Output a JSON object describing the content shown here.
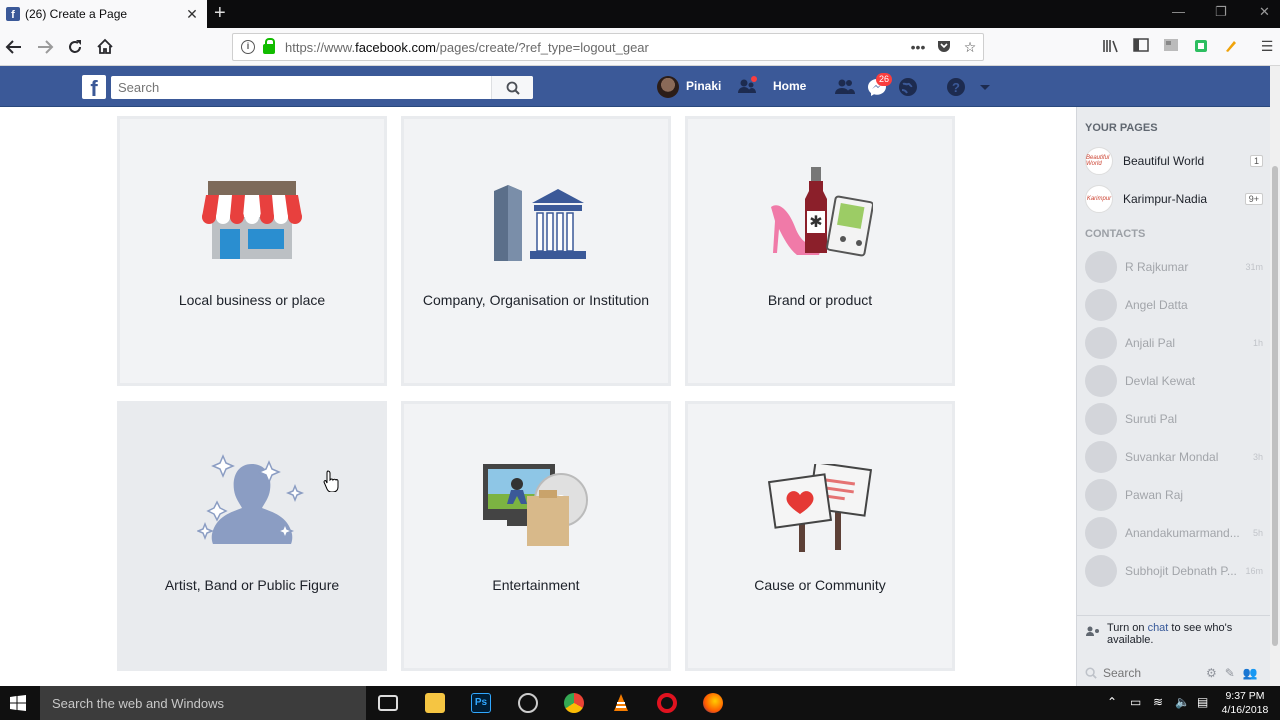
{
  "browser": {
    "tab_title": "(26) Create a Page",
    "tab_favicon": "f",
    "url_prefix": "https://www.",
    "url_domain": "facebook.com",
    "url_path": "/pages/create/?ref_type=logout_gear"
  },
  "fb": {
    "logo": "f",
    "search_placeholder": "Search",
    "user_name": "Pinaki",
    "home_label": "Home",
    "messages_badge": "26",
    "brand_color": "#3b5998"
  },
  "categories": [
    {
      "label": "Local business or place"
    },
    {
      "label": "Company, Organisation or Institution"
    },
    {
      "label": "Brand or product"
    },
    {
      "label": "Artist, Band or Public Figure"
    },
    {
      "label": "Entertainment"
    },
    {
      "label": "Cause or Community"
    }
  ],
  "sidebar": {
    "pages_heading": "YOUR PAGES",
    "pages": [
      {
        "name": "Beautiful World",
        "badge": "1",
        "avatar_text": "Beautiful World"
      },
      {
        "name": "Karimpur-Nadia",
        "badge": "9+",
        "avatar_text": "Karimpur"
      }
    ],
    "contacts_heading": "CONTACTS",
    "contacts": [
      {
        "name": "R Rajkumar",
        "time": "31m"
      },
      {
        "name": "Angel Datta",
        "time": ""
      },
      {
        "name": "Anjali Pal",
        "time": "1h"
      },
      {
        "name": "Devlal Kewat",
        "time": ""
      },
      {
        "name": "Suruti Pal",
        "time": ""
      },
      {
        "name": "Suvankar Mondal",
        "time": "3h"
      },
      {
        "name": "Pawan Raj",
        "time": ""
      },
      {
        "name": "Anandakumarmand...",
        "time": "5h"
      },
      {
        "name": "Subhojit Debnath P...",
        "time": "16m"
      }
    ],
    "chat_note_prefix": "Turn on ",
    "chat_note_link": "chat",
    "chat_note_suffix": " to see who's available.",
    "chat_search_placeholder": "Search"
  },
  "taskbar": {
    "search_text": "Search the web and Windows",
    "time": "9:37 PM",
    "date": "4/16/2018"
  }
}
